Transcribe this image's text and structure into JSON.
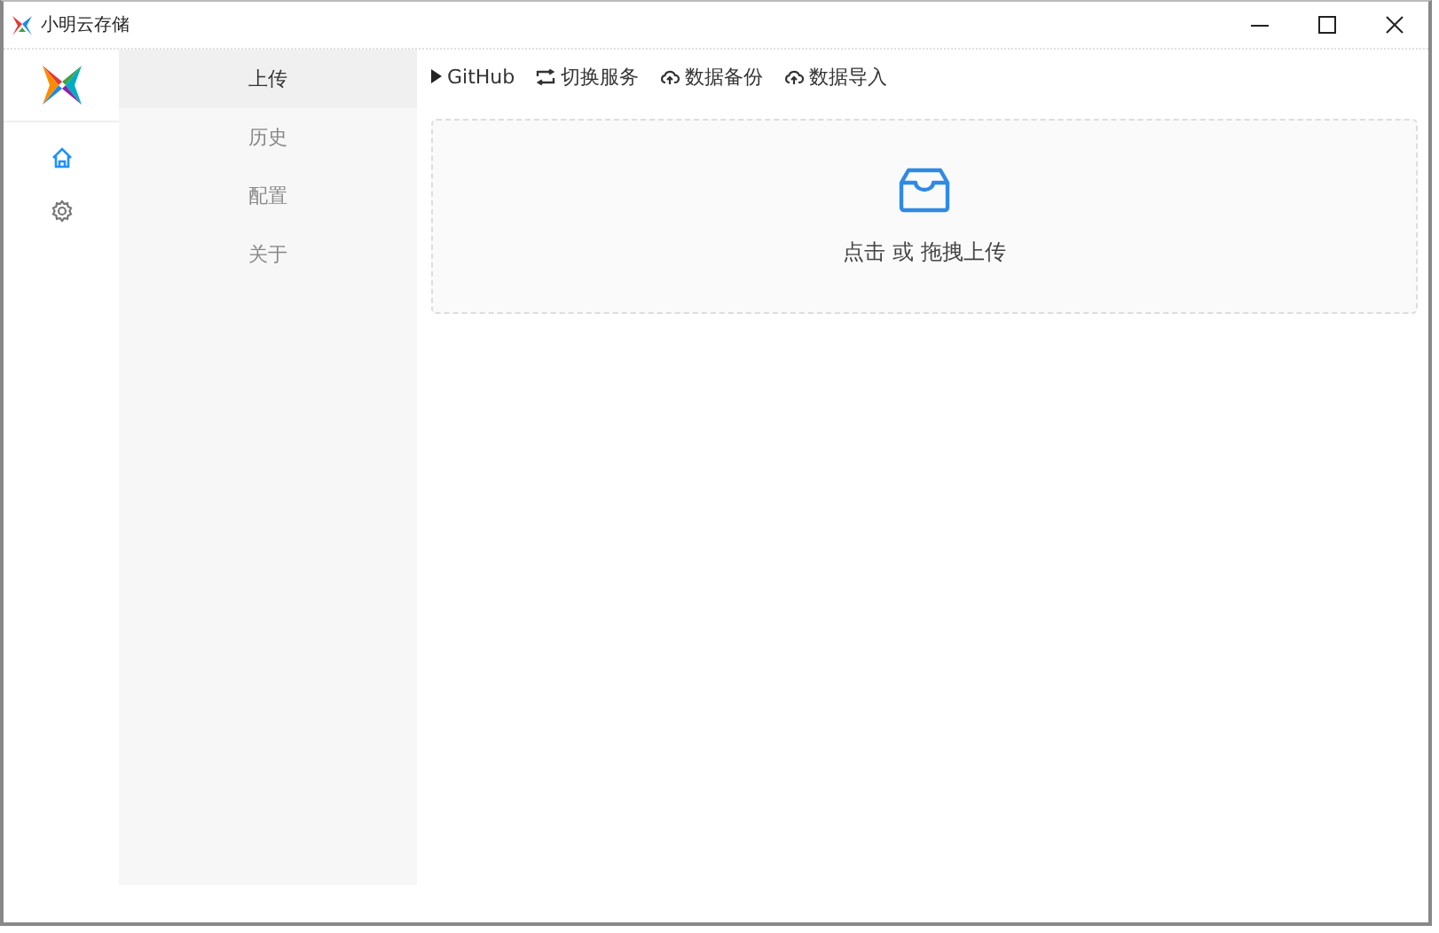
{
  "window": {
    "title": "小明云存储"
  },
  "rail": [
    {
      "kind": "home",
      "selected": true
    },
    {
      "kind": "settings",
      "selected": false
    }
  ],
  "menu": [
    {
      "label": "上传",
      "selected": true
    },
    {
      "label": "历史",
      "selected": false
    },
    {
      "label": "配置",
      "selected": false
    },
    {
      "label": "关于",
      "selected": false
    }
  ],
  "toolbar": [
    {
      "kind": "play",
      "label": "GitHub"
    },
    {
      "kind": "swap",
      "label": "切换服务"
    },
    {
      "kind": "cloud",
      "label": "数据备份"
    },
    {
      "kind": "cloud",
      "label": "数据导入"
    }
  ],
  "dropzone": {
    "text": "点击 或 拖拽上传"
  }
}
